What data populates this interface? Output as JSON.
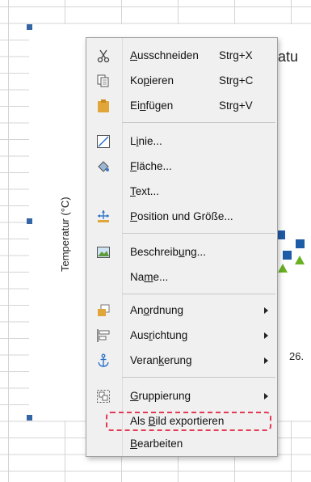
{
  "chart": {
    "title_partial": "ratu",
    "axis_label": "Temperatur (°C)",
    "x_label_partial": "26.",
    "marker_colors": {
      "square": "#1f5ca8",
      "triangle": "#6ab023"
    }
  },
  "menu": {
    "items": [
      {
        "label": "Ausschneiden",
        "mnemonic": "A",
        "shortcut": "Strg+X",
        "icon": "scissors-icon"
      },
      {
        "label": "Kopieren",
        "mnemonic": "p",
        "shortcut": "Strg+C",
        "icon": "copy-icon"
      },
      {
        "label": "Einfügen",
        "mnemonic": "n",
        "shortcut": "Strg+V",
        "icon": "paste-icon"
      },
      {
        "label": "Linie...",
        "mnemonic": "i",
        "icon": "line-icon"
      },
      {
        "label": "Fläche...",
        "mnemonic": "F",
        "icon": "area-icon"
      },
      {
        "label": "Text...",
        "mnemonic": "T"
      },
      {
        "label": "Position und Größe...",
        "mnemonic": "P",
        "icon": "position-size-icon"
      },
      {
        "label": "Beschreibung...",
        "mnemonic": "u",
        "icon": "description-icon"
      },
      {
        "label": "Name...",
        "mnemonic": "m"
      },
      {
        "label": "Anordnung",
        "mnemonic": "o",
        "icon": "arrange-icon",
        "submenu": true
      },
      {
        "label": "Ausrichtung",
        "mnemonic": "r",
        "icon": "align-icon",
        "submenu": true
      },
      {
        "label": "Verankerung",
        "mnemonic": "k",
        "icon": "anchor-icon",
        "submenu": true
      },
      {
        "label": "Gruppierung",
        "mnemonic": "G",
        "icon": "group-icon",
        "submenu": true
      },
      {
        "label": "Als Bild exportieren",
        "mnemonic": "B",
        "highlighted": true
      },
      {
        "label": "Bearbeiten",
        "mnemonic": "B"
      }
    ],
    "highlight_color": "#e33b57"
  }
}
